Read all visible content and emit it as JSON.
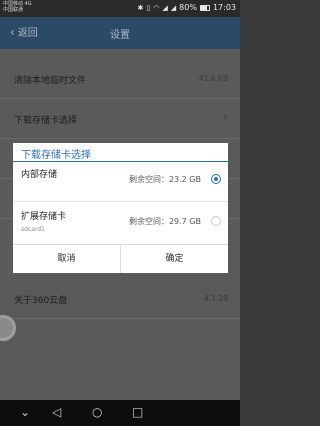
{
  "status": {
    "carrier1": "中国移动 4G",
    "carrier2": "中国联通",
    "battery": "80%",
    "time": "17:03",
    "icons": [
      "bluetooth-icon",
      "vibrate-icon",
      "wifi-icon",
      "signal-icon",
      "battery-icon"
    ]
  },
  "app_bar": {
    "back_label": "返回",
    "title": "设置"
  },
  "settings": [
    {
      "label": "清除本地临时文件",
      "value": "41.6 KB"
    },
    {
      "label": "下载存储卡选择",
      "value": ""
    },
    {
      "label": "",
      "value": ""
    },
    {
      "label": "",
      "value": ""
    },
    {
      "label": "关于360云盘",
      "value": "4.1.29"
    }
  ],
  "dialog": {
    "title": "下载存储卡选择",
    "options": [
      {
        "name": "内部存储",
        "sub": "",
        "space": "剩余空间：23.2 GB",
        "selected": true
      },
      {
        "name": "扩展存储卡",
        "sub": "sdcard1",
        "space": "剩余空间：29.7 GB",
        "selected": false
      }
    ],
    "cancel": "取消",
    "confirm": "确定"
  },
  "colors": {
    "accent": "#2e6fb1",
    "app_bar": "#2c4a66"
  }
}
